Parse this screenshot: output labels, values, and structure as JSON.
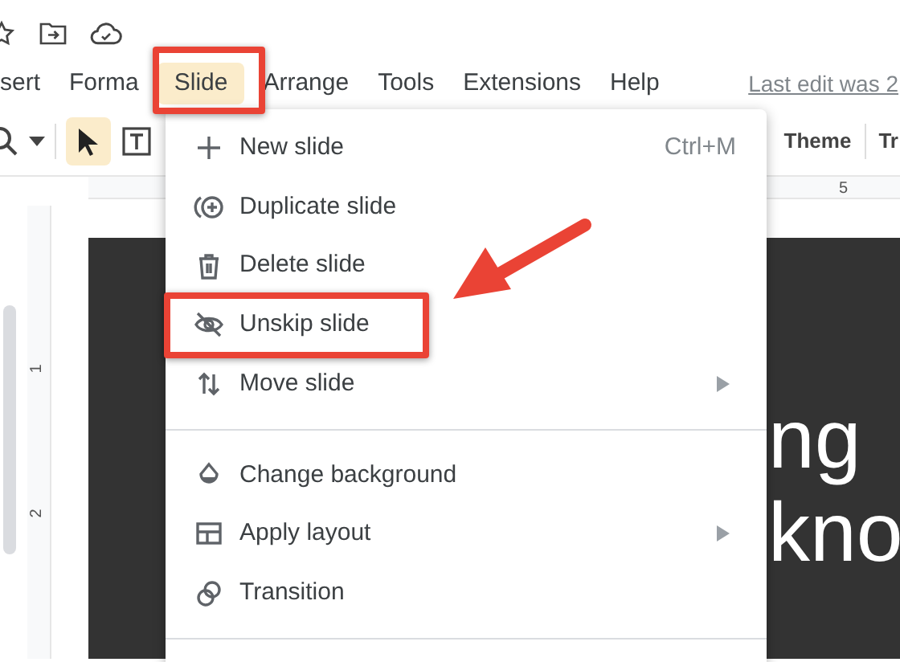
{
  "menu_bar": [
    {
      "label": "sert",
      "selected": false
    },
    {
      "label": "Forma",
      "selected": false
    },
    {
      "label": "Slide",
      "selected": true
    },
    {
      "label": "Arrange",
      "selected": false
    },
    {
      "label": "Tools",
      "selected": false
    },
    {
      "label": "Extensions",
      "selected": false
    },
    {
      "label": "Help",
      "selected": false
    }
  ],
  "last_edit": "Last edit was 2",
  "toolbar": {
    "right_buttons": [
      "Theme",
      "Tr"
    ]
  },
  "ruler": {
    "horizontal_marks": [
      "5"
    ],
    "vertical_marks": [
      "1",
      "2"
    ]
  },
  "slide": {
    "text_lines": [
      "ng",
      "kno"
    ]
  },
  "slide_menu": [
    {
      "kind": "item",
      "label": "New slide",
      "shortcut": "Ctrl+M",
      "submenu": false
    },
    {
      "kind": "item",
      "label": "Duplicate slide",
      "submenu": false
    },
    {
      "kind": "item",
      "label": "Delete slide",
      "submenu": false
    },
    {
      "kind": "item",
      "label": "Unskip slide",
      "submenu": false
    },
    {
      "kind": "item",
      "label": "Move slide",
      "submenu": true
    },
    {
      "kind": "divider"
    },
    {
      "kind": "item",
      "label": "Change background",
      "submenu": false
    },
    {
      "kind": "item",
      "label": "Apply layout",
      "submenu": true
    },
    {
      "kind": "item",
      "label": "Transition",
      "submenu": false
    },
    {
      "kind": "divider"
    }
  ]
}
